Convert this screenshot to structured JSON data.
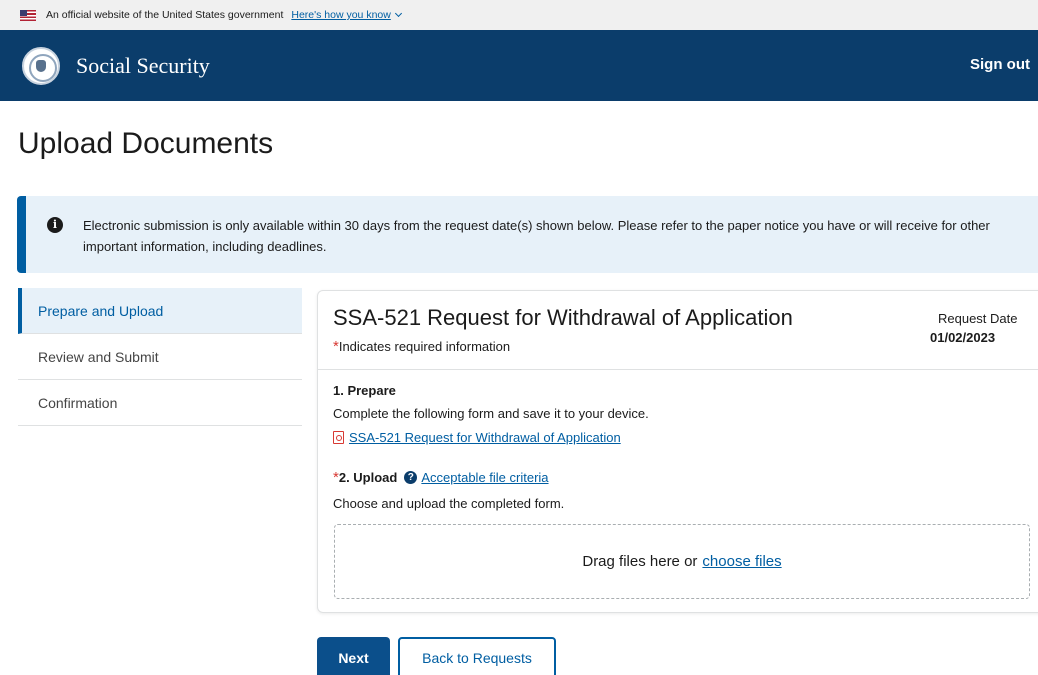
{
  "gov_banner": {
    "text": "An official website of the United States government",
    "link": "Here's how you know"
  },
  "header": {
    "brand": "Social Security",
    "sign_out": "Sign out"
  },
  "page": {
    "title": "Upload Documents"
  },
  "alert": {
    "text": "Electronic submission is only available within 30 days from the request date(s) shown below. Please refer to the paper notice you have or will receive for other important information, including deadlines."
  },
  "sidenav": {
    "items": [
      {
        "label": "Prepare and Upload",
        "active": true
      },
      {
        "label": "Review and Submit",
        "active": false
      },
      {
        "label": "Confirmation",
        "active": false
      }
    ]
  },
  "form": {
    "title": "SSA-521 Request for Withdrawal of Application",
    "required_note": "Indicates required information",
    "request_date_label": "Request Date",
    "request_date_value": "01/02/2023",
    "step1_label": "1. Prepare",
    "step1_text": "Complete the following form and save it to your device.",
    "form_link": "SSA-521 Request for Withdrawal of Application",
    "step2_label": "2. Upload",
    "criteria_link": "Acceptable file criteria",
    "step2_text": "Choose and upload the completed form.",
    "dropzone_text": "Drag files here or",
    "dropzone_link": "choose files"
  },
  "buttons": {
    "next": "Next",
    "back": "Back to Requests"
  },
  "colors": {
    "header_bg": "#0b3d6b",
    "accent": "#005ea2",
    "alert_bg": "#e7f1f9",
    "required": "#d83933"
  }
}
